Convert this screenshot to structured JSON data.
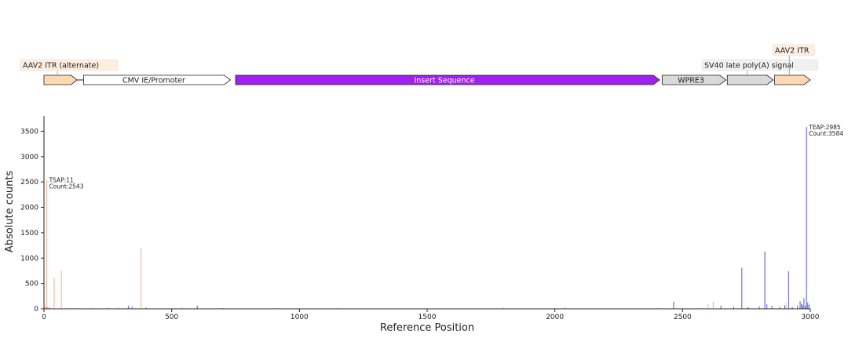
{
  "chart_data": {
    "type": "bar",
    "xlabel": "Reference Position",
    "ylabel": "Absolute counts",
    "xlim": [
      0,
      3000
    ],
    "ylim": [
      0,
      3800
    ],
    "xticks": [
      0,
      500,
      1000,
      1500,
      2000,
      2500,
      3000
    ],
    "yticks": [
      0,
      500,
      1000,
      1500,
      2000,
      2500,
      3000,
      3500
    ],
    "colors": {
      "series_a": "#f4a582",
      "series_b": "#3333dd"
    },
    "series": [
      {
        "color": "#f4a582",
        "points": [
          [
            5,
            60
          ],
          [
            8,
            30
          ],
          [
            11,
            2543
          ],
          [
            14,
            40
          ],
          [
            20,
            25
          ],
          [
            40,
            600
          ],
          [
            68,
            750
          ],
          [
            100,
            15
          ],
          [
            190,
            20
          ],
          [
            230,
            12
          ],
          [
            290,
            25
          ],
          [
            335,
            18
          ],
          [
            380,
            1190
          ],
          [
            540,
            30
          ],
          [
            560,
            12
          ],
          [
            620,
            10
          ],
          [
            880,
            8
          ],
          [
            1150,
            20
          ],
          [
            1800,
            25
          ],
          [
            2040,
            35
          ],
          [
            2300,
            10
          ],
          [
            2600,
            90
          ],
          [
            2620,
            140
          ],
          [
            2700,
            30
          ],
          [
            2760,
            20
          ],
          [
            2850,
            15
          ],
          [
            2900,
            40
          ],
          [
            2905,
            110
          ],
          [
            2925,
            25
          ],
          [
            2985,
            25
          ]
        ]
      },
      {
        "color": "#3333dd",
        "points": [
          [
            20,
            20
          ],
          [
            130,
            10
          ],
          [
            250,
            15
          ],
          [
            330,
            60
          ],
          [
            345,
            40
          ],
          [
            400,
            25
          ],
          [
            600,
            60
          ],
          [
            700,
            15
          ],
          [
            900,
            10
          ],
          [
            1300,
            8
          ],
          [
            2000,
            10
          ],
          [
            2400,
            12
          ],
          [
            2465,
            140
          ],
          [
            2560,
            12
          ],
          [
            2650,
            60
          ],
          [
            2700,
            40
          ],
          [
            2732,
            810
          ],
          [
            2755,
            35
          ],
          [
            2800,
            50
          ],
          [
            2822,
            1130
          ],
          [
            2830,
            90
          ],
          [
            2850,
            60
          ],
          [
            2880,
            40
          ],
          [
            2900,
            70
          ],
          [
            2915,
            740
          ],
          [
            2930,
            30
          ],
          [
            2950,
            60
          ],
          [
            2960,
            150
          ],
          [
            2965,
            100
          ],
          [
            2970,
            80
          ],
          [
            2975,
            210
          ],
          [
            2980,
            60
          ],
          [
            2985,
            3584
          ],
          [
            2990,
            120
          ],
          [
            2995,
            80
          ]
        ]
      }
    ],
    "annotations": [
      {
        "x": 11,
        "y": 2543,
        "lines": [
          "TSAP:11",
          "Count:2543"
        ],
        "pos": "right"
      },
      {
        "x": 2985,
        "y": 3584,
        "lines": [
          "TEAP:2985",
          "Count:3584"
        ],
        "pos": "right"
      }
    ],
    "features": [
      {
        "label": "AAV2 ITR (alternate)",
        "start": 0,
        "end": 130,
        "fill": "#fcd8b4",
        "text_color": "#222222",
        "label_pos": "above-left",
        "callout": true
      },
      {
        "label": "CMV IE/Promoter",
        "start": 155,
        "end": 730,
        "fill": "#ffffff",
        "text_color": "#222222",
        "label_pos": "inside",
        "callout": false
      },
      {
        "label": "Insert Sequence",
        "start": 750,
        "end": 2410,
        "fill": "#a020f0",
        "text_color": "#ffffff",
        "label_pos": "inside",
        "callout": false
      },
      {
        "label": "WPRE3",
        "start": 2420,
        "end": 2670,
        "fill": "#d9d9d9",
        "text_color": "#222222",
        "label_pos": "inside",
        "callout": false
      },
      {
        "label": "SV40 late poly(A) signal",
        "start": 2675,
        "end": 2855,
        "fill": "#d9d9d9",
        "text_color": "#222222",
        "label_pos": "above-gray",
        "callout": true
      },
      {
        "label": "AAV2 ITR",
        "start": 2860,
        "end": 3000,
        "fill": "#fcd8b4",
        "text_color": "#222222",
        "label_pos": "above-high",
        "callout": true
      }
    ],
    "feature_line": {
      "start": 130,
      "end": 155
    },
    "grid": false
  }
}
